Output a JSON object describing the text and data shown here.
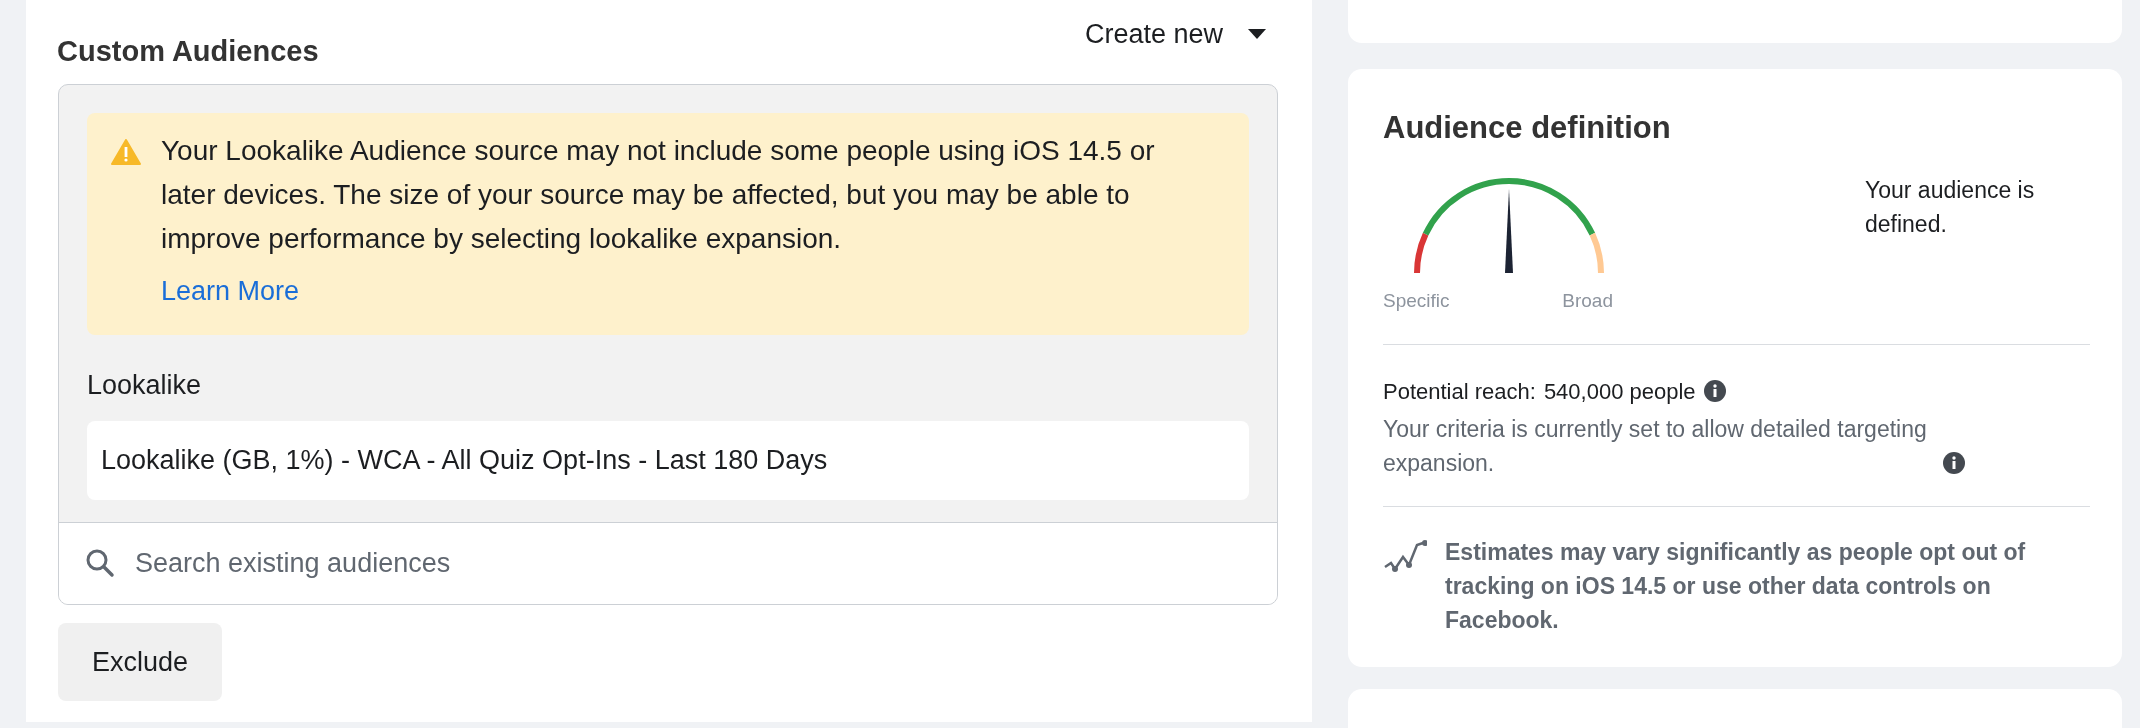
{
  "custom_audiences": {
    "title": "Custom Audiences",
    "create_new": "Create new",
    "warning": {
      "text": "Your Lookalike Audience source may not include some people using iOS 14.5 or later devices. The size of your source may be affected, but you may be able to improve performance by selecting lookalike expansion.",
      "link": "Learn More"
    },
    "group_label": "Lookalike",
    "selected_audiences": [
      "Lookalike (GB, 1%) - WCA - All Quiz Opt-Ins - Last 180 Days"
    ],
    "search": {
      "placeholder": "Search existing audiences"
    },
    "exclude_button": "Exclude"
  },
  "audience_definition": {
    "title": "Audience definition",
    "gauge": {
      "level": 0.5,
      "low_label": "Specific",
      "high_label": "Broad"
    },
    "status": "Your audience is defined.",
    "reach_label": "Potential reach:",
    "reach_value": "540,000 people",
    "criteria_note": "Your criteria is currently set to allow detailed targeting expansion.",
    "estimate_note": "Estimates may vary significantly as people opt out of tracking on iOS 14.5 or use other data controls on Facebook."
  }
}
